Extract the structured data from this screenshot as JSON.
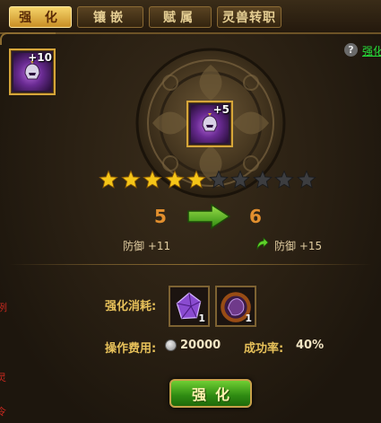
{
  "tabs": [
    {
      "label": "强 化",
      "active": true
    },
    {
      "label": "镶嵌",
      "active": false
    },
    {
      "label": "赋属",
      "active": false
    },
    {
      "label": "灵兽转职",
      "active": false
    }
  ],
  "help": {
    "icon": "question-icon",
    "link": "强化"
  },
  "equipped_item": {
    "icon": "helmet-icon",
    "level": "+10"
  },
  "target_item": {
    "icon": "helmet-icon",
    "level": "+5"
  },
  "stars": {
    "filled": 5,
    "total": 10,
    "filled_color": "#f5c518",
    "empty_color": "#3c3d40"
  },
  "upgrade": {
    "current_level": "5",
    "next_level": "6",
    "current_stat": "防御 +11",
    "next_stat": "防御 +15"
  },
  "cost": {
    "label": "强化消耗:",
    "materials": [
      {
        "icon": "purple-gem-icon",
        "qty": "1"
      },
      {
        "icon": "flame-stone-icon",
        "qty": "1"
      }
    ]
  },
  "fee": {
    "label": "操作费用:",
    "icon": "silver-coin-icon",
    "value": "20000"
  },
  "success": {
    "label": "成功率:",
    "value": "40%"
  },
  "action_button": {
    "label": "强化"
  },
  "side_chars": [
    "例",
    "灵",
    "令"
  ],
  "colors": {
    "accent_gold": "#e7c15a",
    "level_orange": "#e28f2e",
    "button_green": "#3aa31a",
    "link_green": "#26e03a"
  }
}
